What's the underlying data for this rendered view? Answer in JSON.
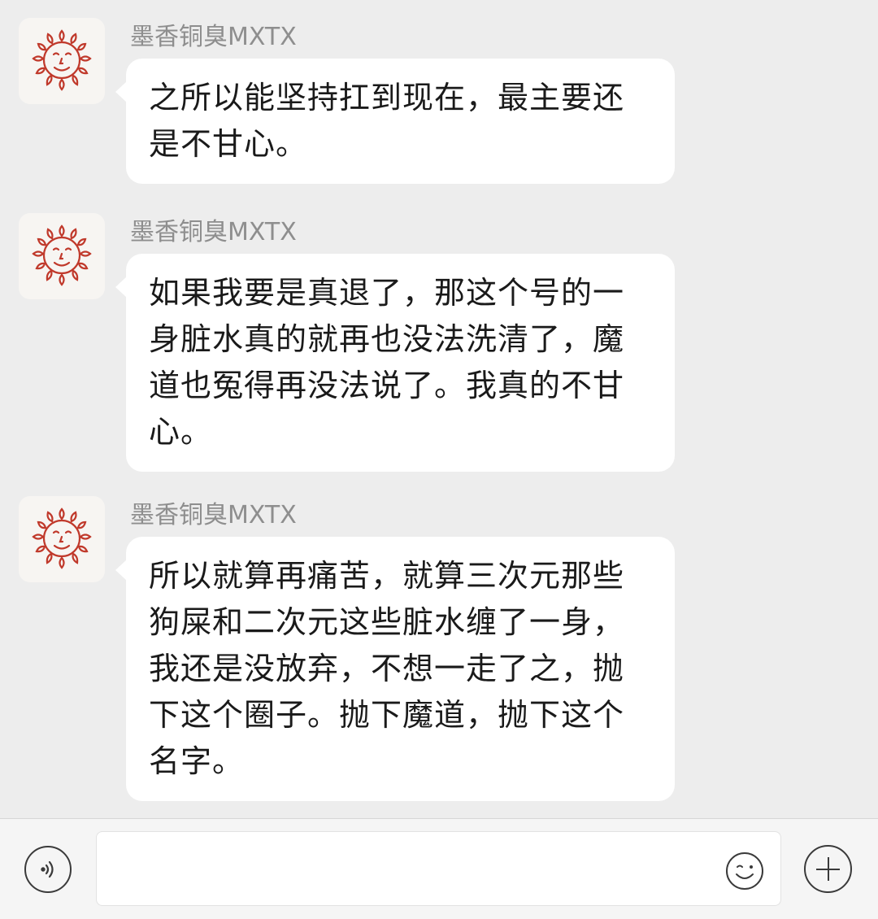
{
  "messages": [
    {
      "sender": "墨香铜臭MXTX",
      "avatar_icon": "sunflower-avatar-icon",
      "text": "之所以能坚持扛到现在，最主要还是不甘心。"
    },
    {
      "sender": "墨香铜臭MXTX",
      "avatar_icon": "sunflower-avatar-icon",
      "text": "如果我要是真退了，那这个号的一身脏水真的就再也没法洗清了，魔道也冤得再没法说了。我真的不甘心。"
    },
    {
      "sender": "墨香铜臭MXTX",
      "avatar_icon": "sunflower-avatar-icon",
      "text": "所以就算再痛苦，就算三次元那些狗屎和二次元这些脏水缠了一身，我还是没放弃，不想一走了之，抛下这个圈子。抛下魔道，抛下这个名字。"
    }
  ],
  "input_bar": {
    "voice_icon": "voice-icon",
    "input_value": "",
    "emoji_icon": "emoji-icon",
    "plus_icon": "plus-icon"
  },
  "colors": {
    "background": "#ededed",
    "bubble": "#ffffff",
    "sender_name": "#8e8e8e",
    "avatar_line": "#c0392b"
  }
}
